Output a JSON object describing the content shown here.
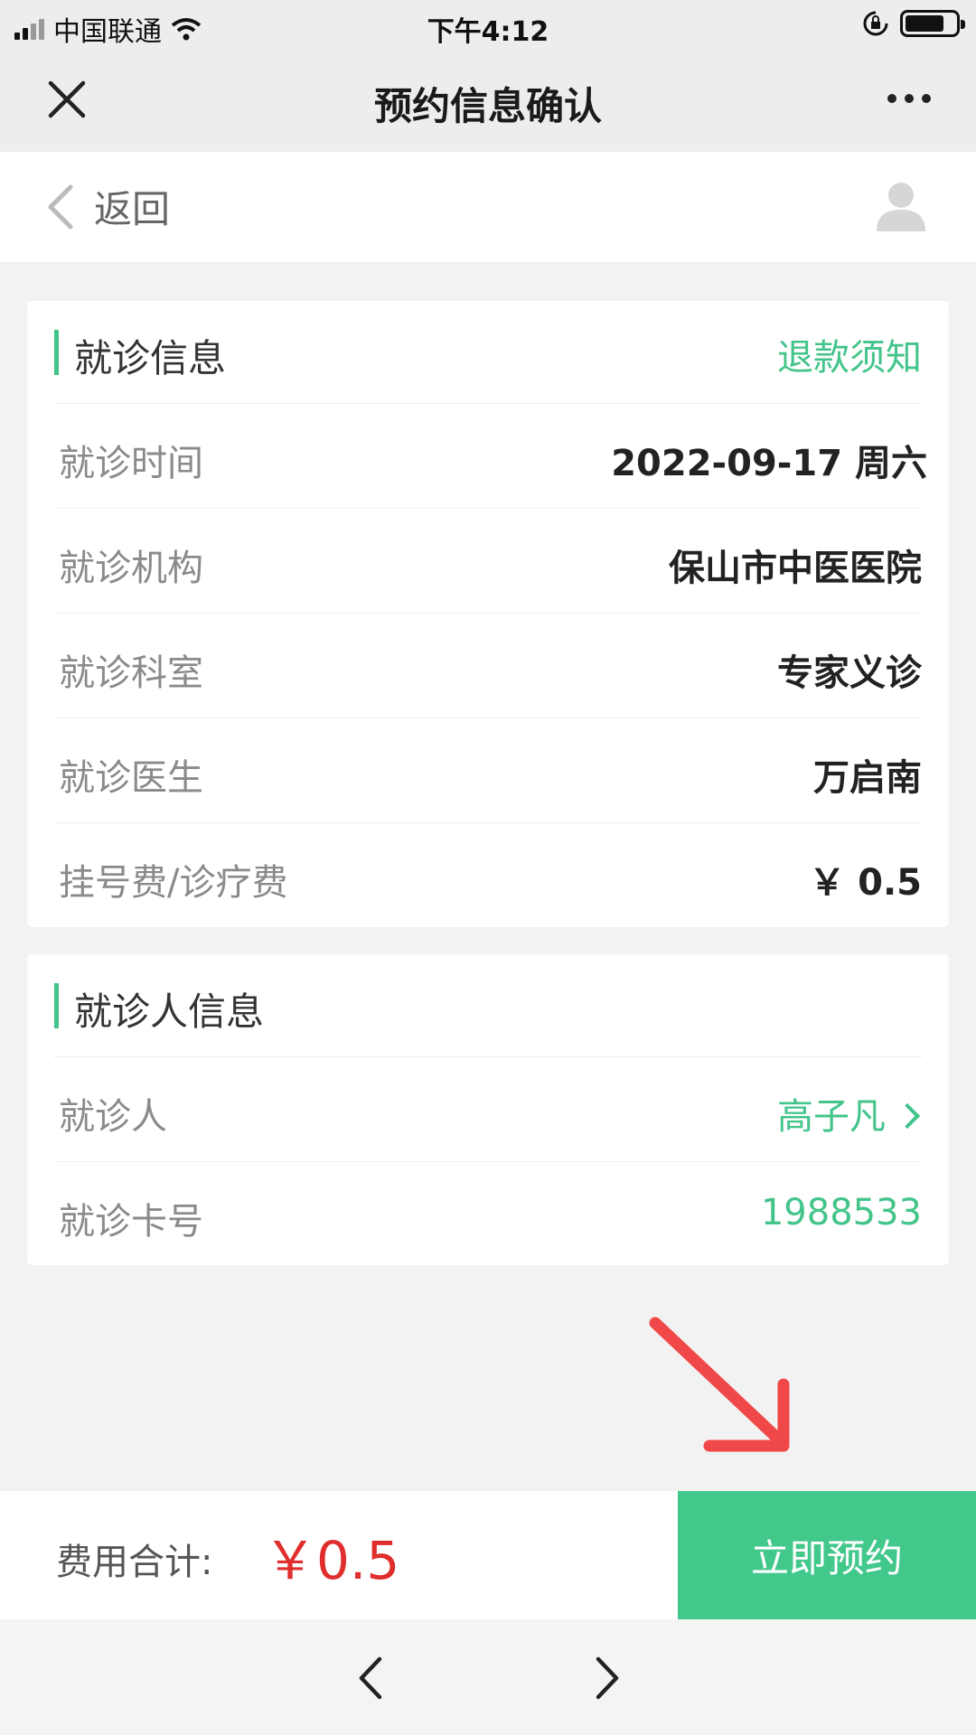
{
  "status_bar": {
    "carrier": "中国联通",
    "time": "下午4:12"
  },
  "title_bar": {
    "title": "预约信息确认"
  },
  "nav": {
    "back_label": "返回"
  },
  "visit_info": {
    "heading": "就诊信息",
    "refund_link": "退款须知",
    "rows": [
      {
        "label": "就诊时间",
        "value": "2022-09-17 周六"
      },
      {
        "label": "就诊机构",
        "value": "保山市中医医院"
      },
      {
        "label": "就诊科室",
        "value": "专家义诊"
      },
      {
        "label": "就诊医生",
        "value": "万启南"
      },
      {
        "label": "挂号费/诊疗费",
        "value": "￥ 0.5"
      }
    ]
  },
  "patient_info": {
    "heading": "就诊人信息",
    "rows": [
      {
        "label": "就诊人",
        "value": "高子凡"
      },
      {
        "label": "就诊卡号",
        "value": "1988533"
      }
    ]
  },
  "footer": {
    "total_label": "费用合计:",
    "total_value": "￥0.5",
    "book_button": "立即预约"
  },
  "colors": {
    "accent": "#43c48a",
    "price": "#e02d2d",
    "annotation_arrow": "#f04848"
  },
  "icons": [
    "close-icon",
    "more-icon",
    "back-chevron-icon",
    "user-avatar-icon",
    "chevron-right-icon",
    "arrow-annotation-icon",
    "prev-page-icon",
    "next-page-icon"
  ]
}
